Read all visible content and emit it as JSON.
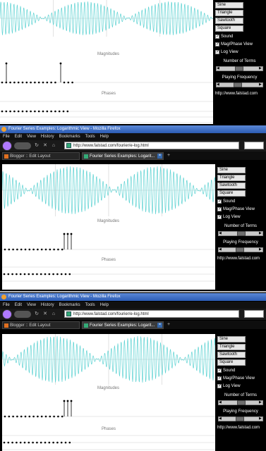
{
  "controls": {
    "buttons": [
      "Sine",
      "Triangle",
      "Sawtooth",
      "Square"
    ],
    "checkboxes": [
      {
        "label": "Sound",
        "checked": true
      },
      {
        "label": "Mag/Phase View",
        "checked": true
      },
      {
        "label": "Log View",
        "checked": true
      }
    ],
    "terms_label": "Number of Terms",
    "freq_label": "Playing Frequency",
    "url": "http://www.falstad.com"
  },
  "applet_labels": {
    "magnitudes": "Magnitudes",
    "phases": "Phases"
  },
  "browser": {
    "window_title": "Fourier Series Examples: Logarithmic View - Mozilla Firefox",
    "menu": [
      "File",
      "Edit",
      "View",
      "History",
      "Bookmarks",
      "Tools",
      "Help"
    ],
    "address": "http://www.falstad.com/fourier/e-log.html",
    "tabs": [
      {
        "label": "Blogger :: Edit Layout",
        "active": false
      },
      {
        "label": "Fourier Series Examples: Logarit...",
        "active": true
      }
    ]
  },
  "colors": {
    "wave": "#5fd3d3",
    "grid": "#cfcfcf",
    "applet_bg": "#ffffff",
    "sidebar_bg": "#000000",
    "dot": "#000000"
  },
  "icons": [
    "firefox-icon",
    "back-arrow-icon",
    "forward-arrow-icon",
    "reload-icon",
    "stop-icon",
    "home-icon",
    "page-favicon",
    "close-tab-icon",
    "new-tab-icon"
  ]
}
